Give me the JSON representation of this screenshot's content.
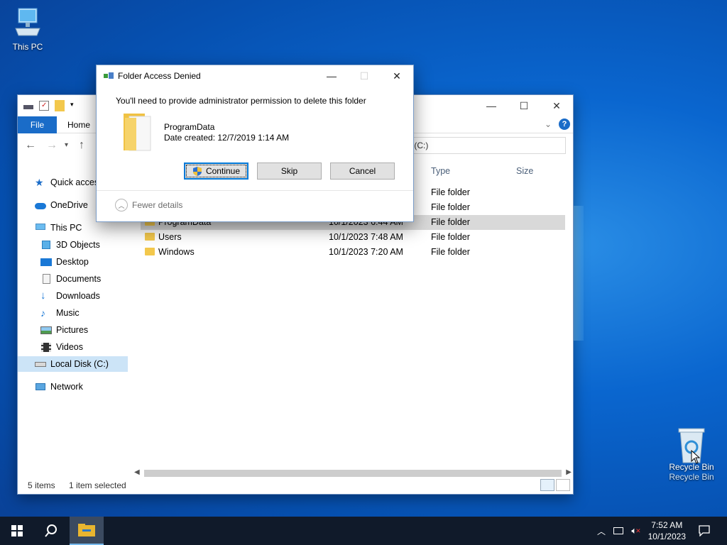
{
  "desktop": {
    "this_pc_label": "This PC",
    "recycle_bin_label": "Recycle Bin",
    "recycle_bin_tooltip": "Recycle Bin"
  },
  "explorer": {
    "tabs": {
      "file": "File",
      "home": "Home"
    },
    "address": "Local Disk (C:)",
    "address_visible": "c (C:)",
    "columns": {
      "type": "Type",
      "size": "Size"
    },
    "sidebar": {
      "quick_access": "Quick access",
      "onedrive": "OneDrive",
      "this_pc": "This PC",
      "objects3d": "3D Objects",
      "desktop": "Desktop",
      "documents": "Documents",
      "downloads": "Downloads",
      "music": "Music",
      "pictures": "Pictures",
      "videos": "Videos",
      "local_disk": "Local Disk (C:)",
      "network": "Network"
    },
    "rows": [
      {
        "name": "",
        "date": "",
        "type": "File folder"
      },
      {
        "name": "",
        "date": "",
        "type": "File folder"
      },
      {
        "name": "ProgramData",
        "date": "10/1/2023 6:44 AM",
        "type": "File folder"
      },
      {
        "name": "Users",
        "date": "10/1/2023 7:48 AM",
        "type": "File folder"
      },
      {
        "name": "Windows",
        "date": "10/1/2023 7:20 AM",
        "type": "File folder"
      }
    ],
    "status": {
      "items": "5 items",
      "selected": "1 item selected"
    }
  },
  "dialog": {
    "title": "Folder Access Denied",
    "message": "You'll need to provide administrator permission to delete this folder",
    "folder_name": "ProgramData",
    "date_created": "Date created: 12/7/2019 1:14 AM",
    "continue_label": "Continue",
    "skip_label": "Skip",
    "cancel_label": "Cancel",
    "fewer_details": "Fewer details"
  },
  "taskbar": {
    "time": "7:52 AM",
    "date": "10/1/2023"
  },
  "colors": {
    "accent": "#0078d7",
    "file_tab": "#1a6cc8",
    "folder": "#f3c84c",
    "taskbar": "#101a2a"
  }
}
